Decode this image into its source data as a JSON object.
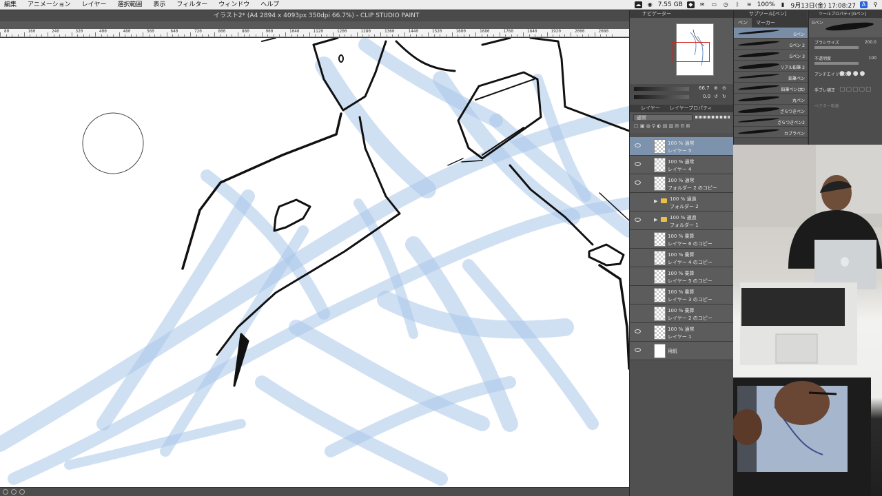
{
  "menubar": {
    "items": [
      "編集",
      "アニメーション",
      "レイヤー",
      "選択範囲",
      "表示",
      "フィルター",
      "ウィンドウ",
      "ヘルプ"
    ],
    "memory": "7.55 GB",
    "battery": "100%",
    "datetime": "9月13日(金) 17:08:27",
    "input_mode": "A"
  },
  "window": {
    "title": "イラスト2* (A4 2894 x 4093px 350dpi 66.7%) - CLIP STUDIO PAINT PRO"
  },
  "ruler": {
    "ticks": [
      "80",
      "160",
      "240",
      "320",
      "400",
      "480",
      "560",
      "640",
      "720",
      "800",
      "880",
      "960",
      "1040",
      "1120",
      "1200",
      "1280",
      "1360",
      "1440",
      "1520",
      "1600",
      "1680",
      "1760",
      "1840",
      "1920",
      "2000",
      "2080"
    ]
  },
  "navigator": {
    "tab": "ナビゲーター",
    "zoom": "66.7",
    "angle": "0.0"
  },
  "layers": {
    "tabs": [
      "レイヤー",
      "レイヤープロパティ"
    ],
    "blend_mode": "通常",
    "rows": [
      {
        "mode": "100 % 通常",
        "name": "レイヤー 5",
        "active": true,
        "visible": true,
        "type": "layer"
      },
      {
        "mode": "100 % 通常",
        "name": "レイヤー 4",
        "active": false,
        "visible": true,
        "type": "layer"
      },
      {
        "mode": "100 % 通常",
        "name": "フォルダー 2 のコピー",
        "active": false,
        "visible": true,
        "type": "layer"
      },
      {
        "mode": "100 % 通過",
        "name": "フォルダー 2",
        "active": false,
        "visible": false,
        "type": "folder"
      },
      {
        "mode": "100 % 通過",
        "name": "フォルダー 1",
        "active": false,
        "visible": true,
        "type": "folder"
      },
      {
        "mode": "100 % 乗算",
        "name": "レイヤー 6 のコピー",
        "active": false,
        "visible": false,
        "type": "layer"
      },
      {
        "mode": "100 % 乗算",
        "name": "レイヤー 4 のコピー",
        "active": false,
        "visible": false,
        "type": "layer"
      },
      {
        "mode": "100 % 乗算",
        "name": "レイヤー 5 のコピー",
        "active": false,
        "visible": false,
        "type": "layer"
      },
      {
        "mode": "100 % 乗算",
        "name": "レイヤー 3 のコピー",
        "active": false,
        "visible": false,
        "type": "layer"
      },
      {
        "mode": "100 % 乗算",
        "name": "レイヤー 2 のコピー",
        "active": false,
        "visible": false,
        "type": "layer"
      },
      {
        "mode": "100 % 通常",
        "name": "レイヤー 1",
        "active": false,
        "visible": true,
        "type": "layer"
      },
      {
        "mode": "",
        "name": "用紙",
        "active": false,
        "visible": true,
        "type": "paper"
      }
    ]
  },
  "subtool": {
    "header": "サブツール[ペン]",
    "tabs": [
      "ペン",
      "マーカー"
    ],
    "pens": [
      "Gペン",
      "Gペン 2",
      "Gペン 3",
      "リアル鉛筆 2",
      "鉛筆ペン",
      "鉛筆ペン(太)",
      "丸ペン",
      "ざらつきペン",
      "ざらつきペン2",
      "カブラペン"
    ]
  },
  "tool_property": {
    "header": "ツールプロパティ[Gペン]",
    "preview_label": "Gペン",
    "brush_size_label": "ブラシサイズ",
    "brush_size": "200.0",
    "opacity_label": "不透明度",
    "opacity": "100",
    "antialias_label": "アンチエイリアス",
    "stabilization_label": "手ブレ補正",
    "vector_label": "ベクター吸着"
  },
  "colors": {
    "accent": "#7d93ad",
    "panel": "#505050",
    "sketch_blue": "#a9c6ea",
    "nav_frame": "#d0241c"
  }
}
